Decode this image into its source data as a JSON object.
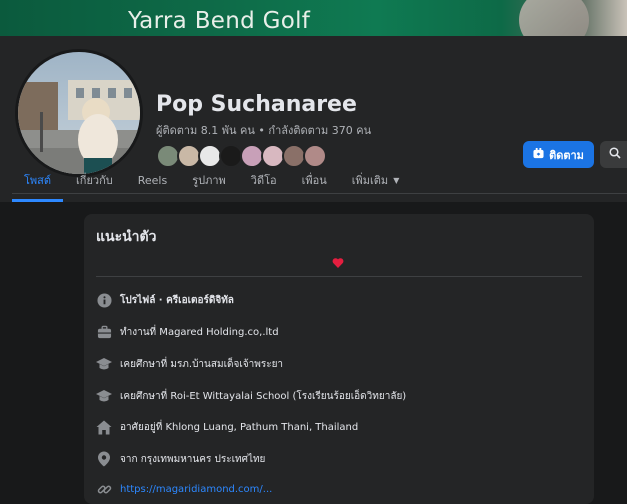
{
  "cover": {
    "text": "Yarra Bend Golf"
  },
  "profile": {
    "name": "Pop Suchanaree",
    "stats": "ผู้ติดตาม 8.1 พัน คน • กำลังติดตาม 370 คน"
  },
  "actions": {
    "follow_label": "ติดตาม"
  },
  "tabs": [
    {
      "label": "โพสต์",
      "active": true
    },
    {
      "label": "เกี่ยวกับ"
    },
    {
      "label": "Reels"
    },
    {
      "label": "รูปภาพ"
    },
    {
      "label": "วิดีโอ"
    },
    {
      "label": "เพื่อน"
    },
    {
      "label": "เพิ่มเติม"
    }
  ],
  "friend_colors": [
    "#7a8a78",
    "#c9b8a6",
    "#e8e8e8",
    "#1a1a1a",
    "#c8a0b8",
    "#d8b8c0",
    "#8a7068",
    "#b08a88"
  ],
  "intro": {
    "title": "แนะนำตัว",
    "heart_color": "#e41e3f",
    "rows": [
      {
        "icon": "info-icon",
        "label": "โปรไฟล์ · ครีเอเตอร์ดิจิทัล"
      },
      {
        "icon": "briefcase-icon",
        "label": "ทำงานที่ Magared Holding.co,.ltd"
      },
      {
        "icon": "graduation-cap-icon",
        "label": "เคยศึกษาที่ มรภ.บ้านสมเด็จเจ้าพระยา"
      },
      {
        "icon": "graduation-cap-icon",
        "label": "เคยศึกษาที่ Roi-Et Wittayalai School (โรงเรียนร้อยเอ็ดวิทยาลัย)"
      },
      {
        "icon": "home-icon",
        "label": "อาศัยอยู่ที่ Khlong Luang, Pathum Thani, Thailand"
      },
      {
        "icon": "location-pin-icon",
        "label": "จาก กรุงเทพมหานคร ประเทศไทย"
      },
      {
        "icon": "link-icon",
        "label": "https://magaridiamond.com/..."
      }
    ]
  }
}
